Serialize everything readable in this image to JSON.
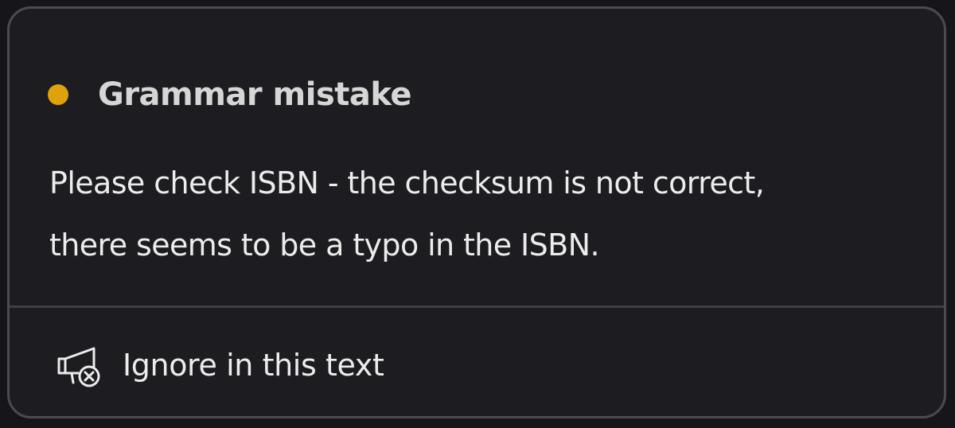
{
  "popup": {
    "category": "Grammar mistake",
    "category_color": "#e0a20b",
    "message_lines": [
      "Please check ISBN - the checksum is not correct,",
      "there seems to be a typo in the ISBN."
    ],
    "action": {
      "label": "Ignore in this text",
      "icon": "ignore-megaphone-icon"
    }
  }
}
